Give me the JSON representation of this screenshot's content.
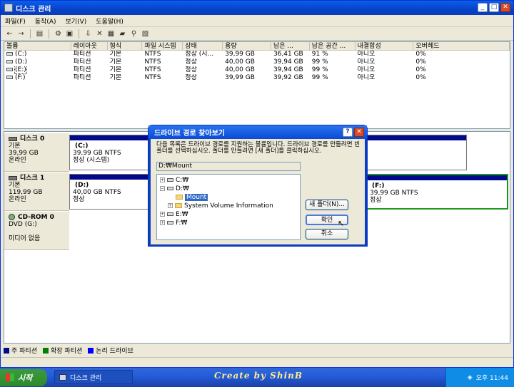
{
  "window": {
    "title": "디스크 관리"
  },
  "menu": [
    "파일(F)",
    "동작(A)",
    "보기(V)",
    "도움말(H)"
  ],
  "toolbar_icons": [
    "back-icon",
    "forward-icon",
    "up-icon",
    "properties-icon",
    "help-icon",
    "connect-icon",
    "delete-icon",
    "open-icon",
    "explore-icon",
    "search-icon",
    "settings-icon"
  ],
  "volume_list": {
    "headers": [
      "볼륨",
      "레이아웃",
      "형식",
      "파일 시스템",
      "상태",
      "용량",
      "남은 ...",
      "남은 공간 ...",
      "내결함성",
      "오버헤드"
    ],
    "rows": [
      [
        "(C:)",
        "파티션",
        "기본",
        "NTFS",
        "정상 (시...",
        "39,99 GB",
        "36,41 GB",
        "91 %",
        "아니오",
        "0%"
      ],
      [
        "(D:)",
        "파티션",
        "기본",
        "NTFS",
        "정상",
        "40,00 GB",
        "39,94 GB",
        "99 %",
        "아니오",
        "0%"
      ],
      [
        "(E:)",
        "파티션",
        "기본",
        "NTFS",
        "정상",
        "40,00 GB",
        "39,94 GB",
        "99 %",
        "아니오",
        "0%"
      ],
      [
        "(F:)",
        "파티션",
        "기본",
        "NTFS",
        "정상",
        "39,99 GB",
        "39,92 GB",
        "99 %",
        "아니오",
        "0%"
      ]
    ]
  },
  "disks": [
    {
      "name": "디스크 0",
      "type": "기본",
      "size": "39,99 GB",
      "status": "온라인",
      "partitions": [
        {
          "name": "(C:)",
          "info": "39,99 GB NTFS",
          "status": "정상 (시스템)"
        }
      ]
    },
    {
      "name": "디스크 1",
      "type": "기본",
      "size": "119,99 GB",
      "status": "온라인",
      "partitions": [
        {
          "name": "(D:)",
          "info": "40,00 GB NTFS",
          "status": "정상"
        },
        {
          "name": "(F:)",
          "info": "39,99 GB NTFS",
          "status": "정상"
        }
      ]
    },
    {
      "name": "CD-ROM 0",
      "type": "DVD (G:)",
      "size": "",
      "status": "미디어 없음",
      "partitions": []
    }
  ],
  "legend": [
    {
      "label": "주 파티션",
      "color": "#000A8A"
    },
    {
      "label": "확장 파티션",
      "color": "#008000"
    },
    {
      "label": "논리 드라이브",
      "color": "#0000FF"
    }
  ],
  "dialog": {
    "title": "드라이브 경로 찾아보기",
    "description": "다음 목록은 드라이브 경로를 지원하는 볼륨입니다. 드라이브 경로를 만들려면 빈 폴더를 선택하십시오. 폴더를 만들려면 [새 폴더]를 클릭하십시오.",
    "path": "D:₩Mount",
    "tree": [
      {
        "label": "C:₩",
        "level": 0,
        "expander": "+",
        "icon": "drive"
      },
      {
        "label": "D:₩",
        "level": 0,
        "expander": "-",
        "icon": "drive"
      },
      {
        "label": "Mount",
        "level": 1,
        "expander": "",
        "icon": "folder",
        "selected": true
      },
      {
        "label": "System Volume Information",
        "level": 1,
        "expander": "+",
        "icon": "folder"
      },
      {
        "label": "E:₩",
        "level": 0,
        "expander": "+",
        "icon": "drive"
      },
      {
        "label": "F:₩",
        "level": 0,
        "expander": "+",
        "icon": "drive"
      }
    ],
    "new_folder": "새 폴더(N)...",
    "ok": "확인",
    "cancel": "취소"
  },
  "taskbar": {
    "start": "시작",
    "task": "디스크 관리",
    "watermark": "Create by ShinB",
    "clock": "오후 11:44"
  }
}
